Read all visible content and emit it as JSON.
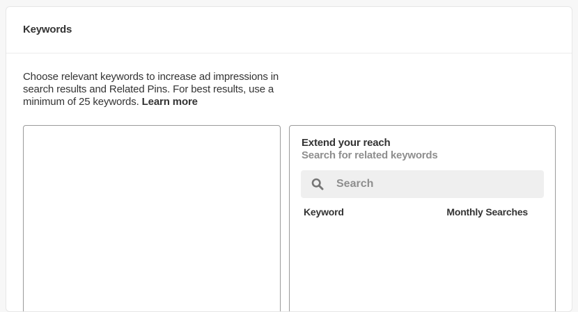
{
  "section": {
    "title": "Keywords"
  },
  "description": {
    "text": "Choose relevant keywords to increase ad impressions in search results and Related Pins. For best results, use a minimum of 25 keywords.",
    "learn_more": "Learn more"
  },
  "keywords_input": {
    "value": ""
  },
  "reach": {
    "title": "Extend your reach",
    "subtitle": "Search for related keywords",
    "search_placeholder": "Search",
    "search_icon": "search-icon",
    "columns": [
      "Keyword",
      "Monthly Searches"
    ]
  },
  "colors": {
    "text": "#333333",
    "muted": "#8e8e8e",
    "search_bg": "#efefef",
    "border": "#9a9a9a"
  }
}
